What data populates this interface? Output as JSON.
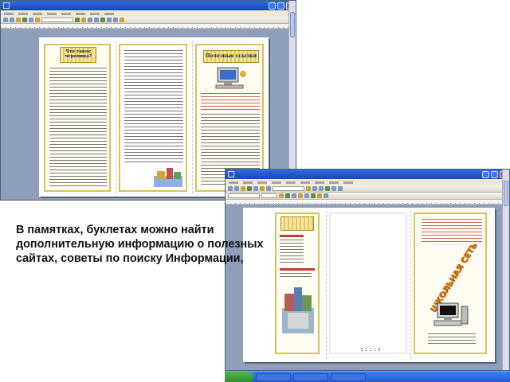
{
  "caption": "В памятках, буклетах можно найти дополнительную информацию о полезных сайтах, советы по поиску Информации,",
  "window_back": {
    "left_banner": "Что такое черепица?",
    "right_banner": "Полезные ссылки"
  },
  "window_front": {
    "center_banner": "Школьная сеть",
    "vertical_title": "ШКОЛЬНАЯ СЕТЬ"
  },
  "icons": [
    "word-app-icon",
    "minimize-icon",
    "maximize-icon",
    "close-icon",
    "computer-illustration-icon",
    "books-illustration-icon"
  ],
  "colors": {
    "titlebar": "#1f55c8",
    "desktop": "#8f9fb9",
    "banner_gold": "#e6c75a",
    "title_red": "#c83a3a",
    "vertical_title_orange": "#e07a10",
    "taskbar": "#2d66e0"
  }
}
